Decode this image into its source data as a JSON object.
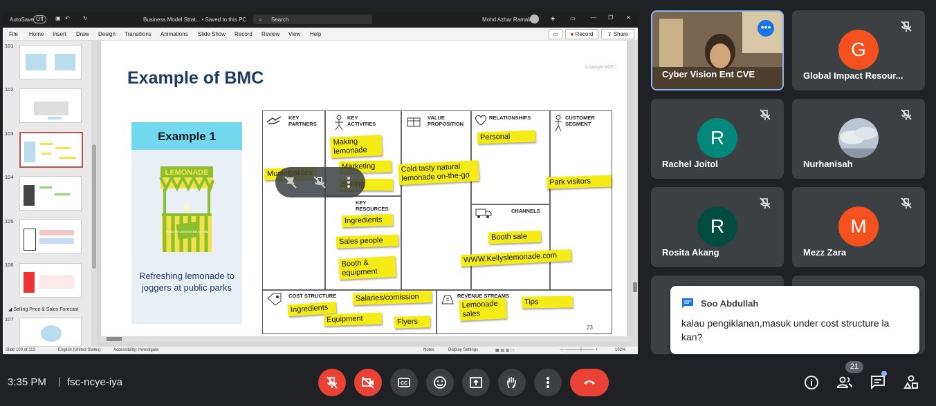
{
  "ppt": {
    "autosave_label": "AutoSave",
    "autosave_state": "Off",
    "doc_title": "Business Model Strat... • Saved to this PC",
    "search_placeholder": "Search",
    "user": "Mohd Azhar Ramali",
    "menu": [
      "File",
      "Home",
      "Insert",
      "Draw",
      "Design",
      "Transitions",
      "Animations",
      "Slide Show",
      "Record",
      "Review",
      "View",
      "Help"
    ],
    "record_btn": "Record",
    "share_btn": "Share",
    "thumb_numbers": [
      "101",
      "102",
      "103",
      "104",
      "105",
      "106",
      "107"
    ],
    "section_label": "Selling Price & Sales Forecast",
    "status": {
      "slide": "Slide 103 of 113",
      "language": "English (United States)",
      "accessibility": "Accessibility: Investigate",
      "notes": "Notes",
      "display": "Display Settings",
      "zoom": "102%"
    }
  },
  "slide": {
    "title": "Example of BMC",
    "copyright": "Copyright MDEC",
    "example_heading": "Example 1",
    "stand_sign": "LEMONADE",
    "stand_board": "KELLY'S LEMONADE STAND",
    "example_caption": "Refreshing lemonade to joggers at public parks",
    "page_number": "23",
    "bmc_labels": {
      "key_partners": "KEY PARTNERS",
      "key_activities": "KEY ACTIVITIES",
      "value_proposition": "VALUE PROPOSITION",
      "relationships": "RELATIONSHIPS",
      "customer_segment": "CUSTOMER SEGMENT",
      "key_resources": "KEY RESOURCES",
      "channels": "CHANNELS",
      "cost_structure": "COST STRUCTURE",
      "revenue_streams": "REVENUE STREAMS"
    },
    "notes": {
      "municipalities": "Municipalities",
      "making_lemonade": "Making lemonade",
      "marketing": "Marketing",
      "selling": "Selling",
      "value": "Cold tasty natural lemonade on-the-go",
      "personal": "Personal",
      "park_visitors": "Park visitors",
      "ingredients": "Ingredients",
      "sales_people": "Sales people",
      "booth_equipment": "Booth & equipment",
      "booth_sale": "Booth sale",
      "website": "WWW.Kellyslemonade.com",
      "cost_ingredients": "Ingredients",
      "salaries": "Salaries/comission",
      "equipment": "Equipment",
      "flyers": "Flyers",
      "lemonade_sales": "Lemonade sales",
      "tips": "Tips"
    }
  },
  "participants": [
    {
      "name": "Cyber Vision Ent CVE",
      "type": "video"
    },
    {
      "name": "Global Impact Resour...",
      "initial": "G",
      "color": "#f4511e"
    },
    {
      "name": "Rachel Joitol",
      "initial": "R",
      "color": "#00897b"
    },
    {
      "name": "Nurhanisah",
      "type": "photo"
    },
    {
      "name": "Rosita Akang",
      "initial": "R",
      "color": "#004d40"
    },
    {
      "name": "Mezz Zara",
      "initial": "M",
      "color": "#f4511e"
    }
  ],
  "chat": {
    "sender": "Soo Abdullah",
    "message": "kalau pengiklanan,masuk under cost structure la kan?"
  },
  "meeting": {
    "time": "3:35 PM",
    "separator": "|",
    "code": "fsc-ncye-iya",
    "people_count": "21"
  },
  "icons": [
    "mic-off-icon",
    "camera-off-icon",
    "captions-icon",
    "emoji-icon",
    "present-icon",
    "raise-hand-icon",
    "more-icon",
    "end-call-icon",
    "info-icon",
    "people-icon",
    "chat-icon",
    "activities-icon"
  ]
}
